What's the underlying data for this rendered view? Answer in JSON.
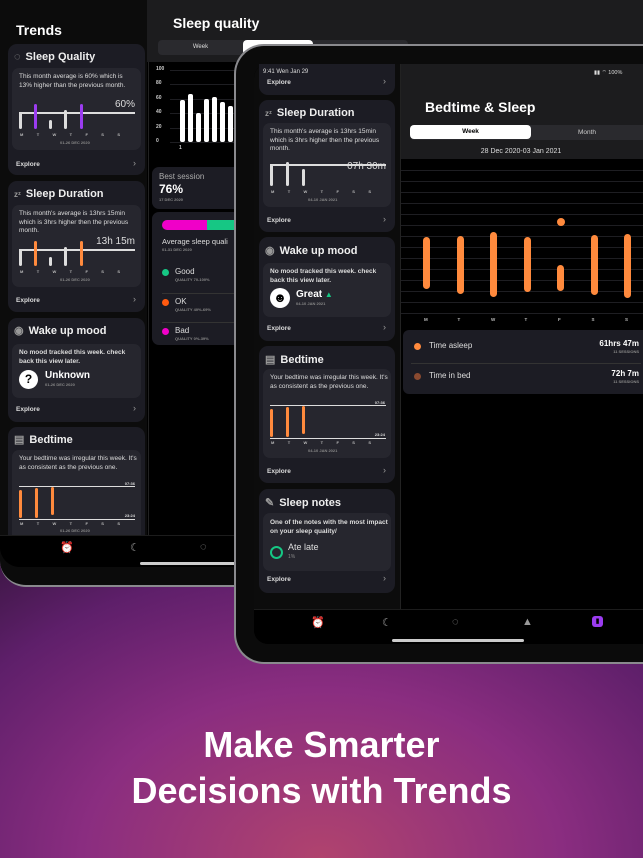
{
  "back_ipad": {
    "sidebar": {
      "title": "Trends",
      "cards": [
        {
          "title": "Sleep Quality",
          "icon": "sleep-quality-ring-icon",
          "text": "This month average is 60% which is 13% higher than the previous month.",
          "value": "60%",
          "days": [
            "M",
            "T",
            "W",
            "T",
            "F",
            "S",
            "S"
          ],
          "range": "01-26 DEC 2020",
          "explore": "Explore",
          "accent": "#9b3cf0"
        },
        {
          "title": "Sleep Duration",
          "icon": "zzz-icon",
          "text": "This month's average is 13hrs 15min which is 3hrs higher then the previous month.",
          "value": "13h 15m",
          "days": [
            "M",
            "T",
            "W",
            "T",
            "F",
            "S",
            "S"
          ],
          "range": "01-26 DEC 2020",
          "explore": "Explore",
          "accent": "#ff8a3d"
        },
        {
          "title": "Wake up mood",
          "icon": "eye-icon",
          "text": "No mood tracked this week. check back this view later.",
          "mood": "Unknown",
          "mood_icon": "question-icon",
          "range": "01-26 DEC 2020",
          "explore": "Explore"
        },
        {
          "title": "Bedtime",
          "icon": "bed-icon",
          "text": "Your bedtime was irregular this week. It's as consistent as the previous one.",
          "top_time": "07:36",
          "bottom_time": "23:24",
          "days": [
            "M",
            "T",
            "W",
            "T",
            "F",
            "S",
            "S"
          ],
          "range": "01-26 DEC 2020"
        }
      ]
    },
    "detail": {
      "title": "Sleep quality",
      "segments": [
        "Week",
        ""
      ],
      "chart": {
        "type": "bar",
        "yticks": [
          "100",
          "80",
          "60",
          "40",
          "20",
          "0"
        ],
        "xlabels": [
          "1"
        ],
        "values": [
          58,
          66,
          40,
          60,
          62,
          56,
          50,
          44
        ],
        "ylim": [
          0,
          100
        ]
      },
      "best_session": {
        "label": "Best session",
        "value": "76%",
        "date": "17 DEC 2020"
      },
      "average": {
        "title": "Average sleep quali",
        "range": "01-31 DEC 2020",
        "bar": {
          "bad_color": "#f000c8",
          "good_color": "#16c784"
        },
        "levels": [
          {
            "name": "Good",
            "range": "QUALITY 70-100%",
            "color": "#16c784"
          },
          {
            "name": "OK",
            "range": "QUALITY 40%-69%",
            "color": "#ff5a10"
          },
          {
            "name": "Bad",
            "range": "QUALITY 0%-39%",
            "color": "#f000c8"
          }
        ]
      }
    },
    "tabbar": [
      "alarm-clock-icon",
      "moon-sleep-icon",
      "sleep-quality-ring-icon"
    ]
  },
  "front_ipad": {
    "status": {
      "time": "9:41  Wen Jan 29",
      "battery": "100%"
    },
    "sidebar": {
      "top_explore": "Explore",
      "duration": {
        "title": "Sleep Duration",
        "text": "This month's average is 13hrs 15min which is 3hrs higher then the previous month.",
        "value": "07h 30m",
        "days": [
          "M",
          "T",
          "W",
          "T",
          "F",
          "S",
          "S"
        ],
        "range": "04-10 JAN 2021",
        "explore": "Explore"
      },
      "mood": {
        "title": "Wake up mood",
        "text": "No mood tracked this week. check back this view later.",
        "mood": "Great",
        "trend": "up",
        "range": "04-10 JAN 2021",
        "explore": "Explore"
      },
      "bedtime": {
        "title": "Bedtime",
        "text": "Your bedtime was irregular this week. It's as consistent as the previous one.",
        "top_time": "07:36",
        "bottom_time": "23:24",
        "days": [
          "M",
          "T",
          "W",
          "T",
          "F",
          "S",
          "S"
        ],
        "range": "04-10 JAN 2021",
        "explore": "Explore"
      },
      "notes": {
        "title": "Sleep notes",
        "text": "One of the notes with the most impact on your sleep quality/",
        "note": "Ate late",
        "percent": "1%",
        "explore": "Explore"
      }
    },
    "detail": {
      "title": "Bedtime & Sleep",
      "segments": [
        {
          "label": "Week",
          "selected": true
        },
        {
          "label": "Month",
          "selected": false
        }
      ],
      "date_range": "28 Dec  2020-03 Jan 2021",
      "chart": {
        "type": "bar",
        "days": [
          "M",
          "T",
          "W",
          "T",
          "F",
          "S",
          "S"
        ],
        "color": "#ff8a3d"
      },
      "legend": [
        {
          "label": "Time asleep",
          "value": "61hrs 47m",
          "sub": "11 SESSIONS",
          "color": "#ff8a3d"
        },
        {
          "label": "Time in bed",
          "value": "72h 7m",
          "sub": "11 SESSIONS",
          "color": "#8a4a30"
        }
      ]
    },
    "tabbar": [
      {
        "icon": "alarm-clock-icon"
      },
      {
        "icon": "moon-sleep-icon"
      },
      {
        "icon": "sleep-quality-ring-icon"
      },
      {
        "icon": "metronome-icon"
      },
      {
        "icon": "trends-chart-icon",
        "active": true,
        "color": "#9b3cf0"
      }
    ]
  },
  "headline": {
    "line1": "Make Smarter",
    "line2": "Decisions with Trends"
  }
}
